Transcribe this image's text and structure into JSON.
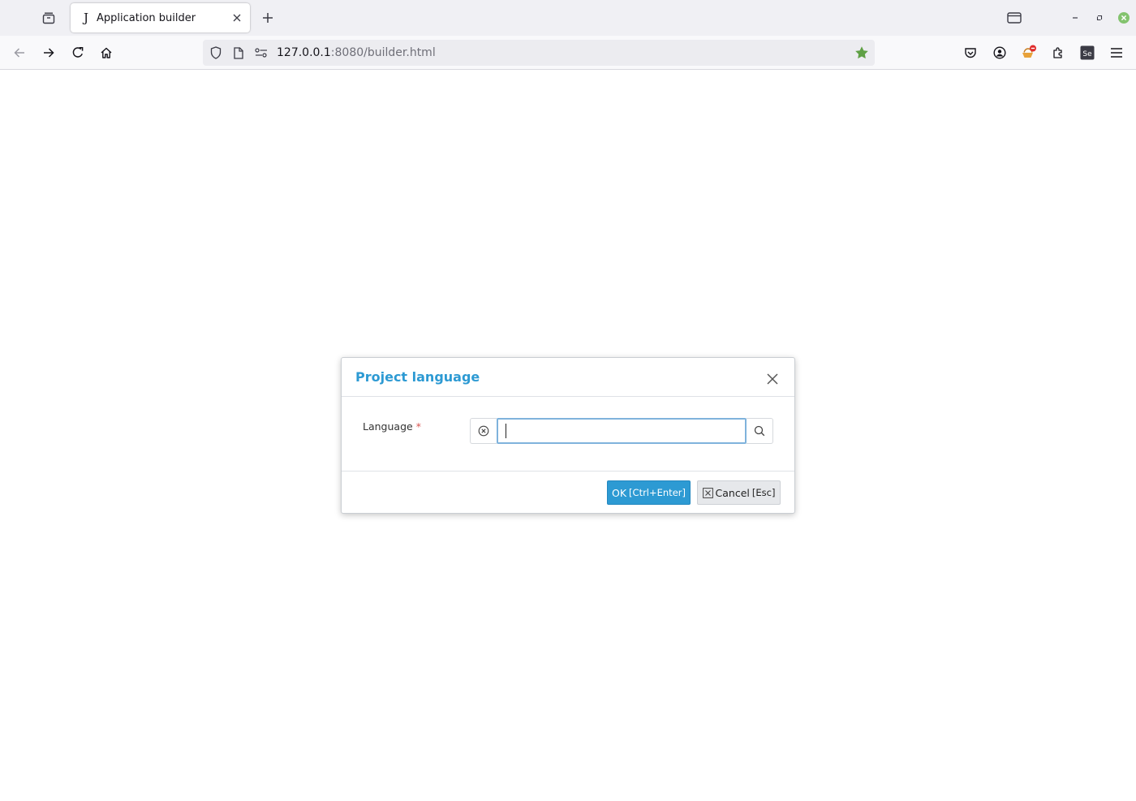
{
  "browser": {
    "tab": {
      "favicon": "J",
      "title": "Application builder"
    },
    "url": {
      "host": "127.0.0.1",
      "path": ":8080/builder.html"
    },
    "icons": {
      "tab_overview": "tab-overview-icon",
      "new_tab": "plus-icon",
      "back": "arrow-left-icon",
      "forward": "arrow-right-icon",
      "reload": "reload-icon",
      "home": "home-icon",
      "bookmark": "star-icon"
    },
    "colors": {
      "bookmark_star": "#5fa045",
      "close_window": "#83c36e"
    }
  },
  "dialog": {
    "title": "Project language",
    "field_label": "Language",
    "required_mark": "*",
    "input_value": "",
    "ok_label": "OK",
    "ok_shortcut": "[Ctrl+Enter]",
    "cancel_label": "Cancel",
    "cancel_shortcut": "[Esc]",
    "accent_color": "#2d9ad3"
  }
}
